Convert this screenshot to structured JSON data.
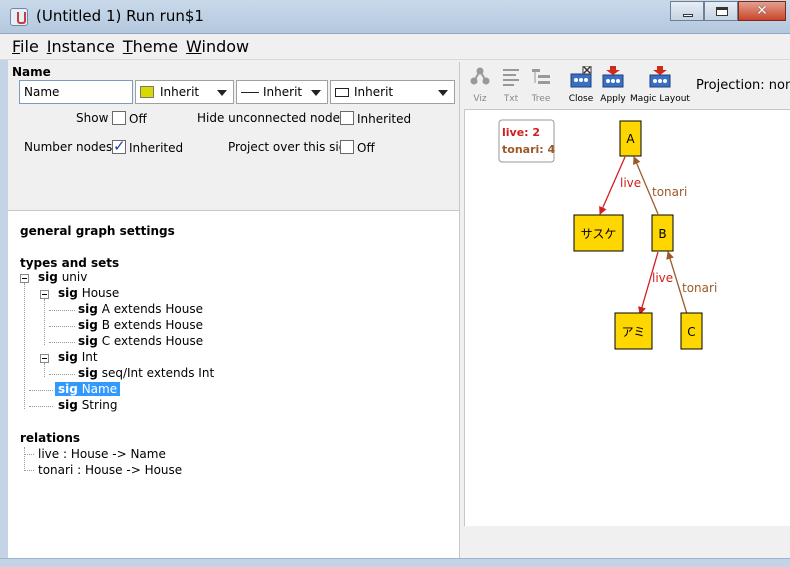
{
  "window": {
    "title": "(Untitled 1) Run run$1"
  },
  "menu": [
    {
      "key": "F",
      "rest": "ile"
    },
    {
      "key": "I",
      "rest": "nstance"
    },
    {
      "key": "T",
      "rest": "heme"
    },
    {
      "key": "W",
      "rest": "indow"
    }
  ],
  "settings": {
    "name_label": "Name",
    "name_value": "Name",
    "color_combo": "Inherit",
    "line_combo": "Inherit",
    "shape_combo": "Inherit",
    "show_label": "Show",
    "show_value": "Off",
    "hide_label": "Hide unconnected nodes",
    "hide_value": "Inherited",
    "number_label": "Number nodes",
    "number_value": "Inherited",
    "project_label": "Project over this sig",
    "project_value": "Off",
    "swatch_color": "#d9d900"
  },
  "tree": {
    "general": "general graph settings",
    "types_header": "types and sets",
    "univ": {
      "kw": "sig",
      "name": "univ"
    },
    "house": {
      "kw": "sig",
      "name": "House"
    },
    "a": {
      "kw": "sig",
      "name": "A extends House"
    },
    "b": {
      "kw": "sig",
      "name": "B extends House"
    },
    "c": {
      "kw": "sig",
      "name": "C extends House"
    },
    "int": {
      "kw": "sig",
      "name": "Int"
    },
    "seqint": {
      "kw": "sig",
      "name": "seq/Int extends Int"
    },
    "name": {
      "kw": "sig",
      "name": "Name"
    },
    "string": {
      "kw": "sig",
      "name": "String"
    },
    "relations_header": "relations",
    "rel_live": "live :  House -> Name",
    "rel_tonari": "tonari :  House -> House"
  },
  "toolbar": {
    "viz": "Viz",
    "txt": "Txt",
    "tree": "Tree",
    "close": "Close",
    "apply": "Apply",
    "magic": "Magic Layout",
    "projection": "Projection: none"
  },
  "graph": {
    "legend_live": "live: 2",
    "legend_tonari": "tonari: 4",
    "node_a": "A",
    "node_b": "B",
    "node_c": "C",
    "node_sasuke": "サスケ",
    "node_ami": "アミ",
    "edge_live_1": "live",
    "edge_live_2": "live",
    "edge_tonari_1": "tonari",
    "edge_tonari_2": "tonari",
    "node_color": "#ffd700",
    "live_color": "#d21e1e",
    "tonari_color": "#9b5a2a"
  }
}
